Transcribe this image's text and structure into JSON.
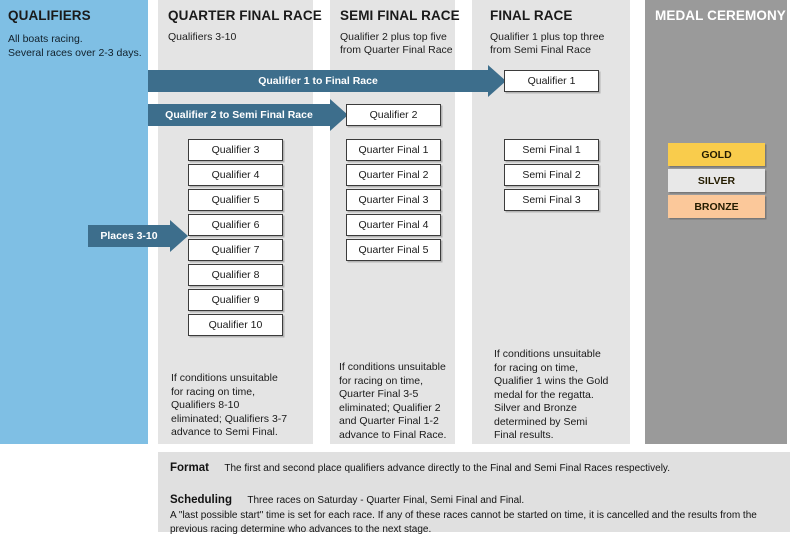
{
  "columns": {
    "qualifiers": {
      "title": "QUALIFIERS",
      "body_line1": "All boats racing.",
      "body_line2": "Several races over 2-3 days.",
      "bg_color": "#7fbfe4"
    },
    "quarter_final": {
      "title": "QUARTER FINAL RACE",
      "subtitle": "Qualifiers 3-10",
      "note": "If conditions unsuitable for racing on time, Qualifiers 8-10 eliminated; Qualifiers 3-7 advance to Semi Final.",
      "note_lines": [
        "If conditions unsuitable",
        "for racing on time,",
        "Qualifiers 8-10",
        "eliminated; Qualifiers 3-7",
        "advance to Semi Final."
      ],
      "boxes": [
        "Qualifier 3",
        "Qualifier 4",
        "Qualifier 5",
        "Qualifier 6",
        "Qualifier 7",
        "Qualifier 8",
        "Qualifier 9",
        "Qualifier 10"
      ]
    },
    "semi_final": {
      "title": "SEMI FINAL RACE",
      "subtitle_line1": "Qualifier 2 plus top five",
      "subtitle_line2": "from Quarter Final Race",
      "note_lines": [
        "If conditions unsuitable",
        "for racing on time,",
        "Quarter Final 3-5",
        "eliminated; Qualifier 2",
        "and Quarter Final 1-2",
        "advance to Final Race."
      ],
      "feeder_box": "Qualifier 2",
      "boxes": [
        "Quarter Final 1",
        "Quarter Final 2",
        "Quarter Final 3",
        "Quarter Final 4",
        "Quarter Final 5"
      ]
    },
    "final": {
      "title": "FINAL RACE",
      "subtitle_line1": "Qualifier 1 plus top three",
      "subtitle_line2": "from Semi Final Race",
      "note_lines": [
        "If conditions unsuitable",
        "for racing on time,",
        "Qualifier 1 wins the Gold",
        "medal for the regatta.",
        "Silver and Bronze",
        "determined by Semi",
        "Final results."
      ],
      "feeder_box": "Qualifier 1",
      "boxes": [
        "Semi Final 1",
        "Semi Final 2",
        "Semi Final 3"
      ]
    },
    "medal_ceremony": {
      "title": "MEDAL CEREMONY",
      "bg_color": "#9a9a9a",
      "medals": [
        {
          "label": "GOLD",
          "color": "#f9cc4c"
        },
        {
          "label": "SILVER",
          "color": "#e8e8e8"
        },
        {
          "label": "BRONZE",
          "color": "#fbc89a"
        }
      ]
    }
  },
  "arrows": {
    "color": "#3d6e8c",
    "items": [
      {
        "label": "Qualifier 1 to Final Race"
      },
      {
        "label": "Qualifier 2 to Semi Final Race"
      },
      {
        "label": "Places 3-10"
      }
    ]
  },
  "footer": {
    "format_keyword": "Format",
    "format_text": "The first and second place qualifiers advance directly to the Final and Semi Final Races respectively.",
    "scheduling_keyword": "Scheduling",
    "scheduling_text": "Three races on Saturday - Quarter Final, Semi Final and Final.",
    "scheduling_line2": "A \"last possible start\" time is set for each race. If any of these races cannot be started on time, it is cancelled and the results from the",
    "scheduling_line3": "previous racing determine who advances to the next stage."
  }
}
